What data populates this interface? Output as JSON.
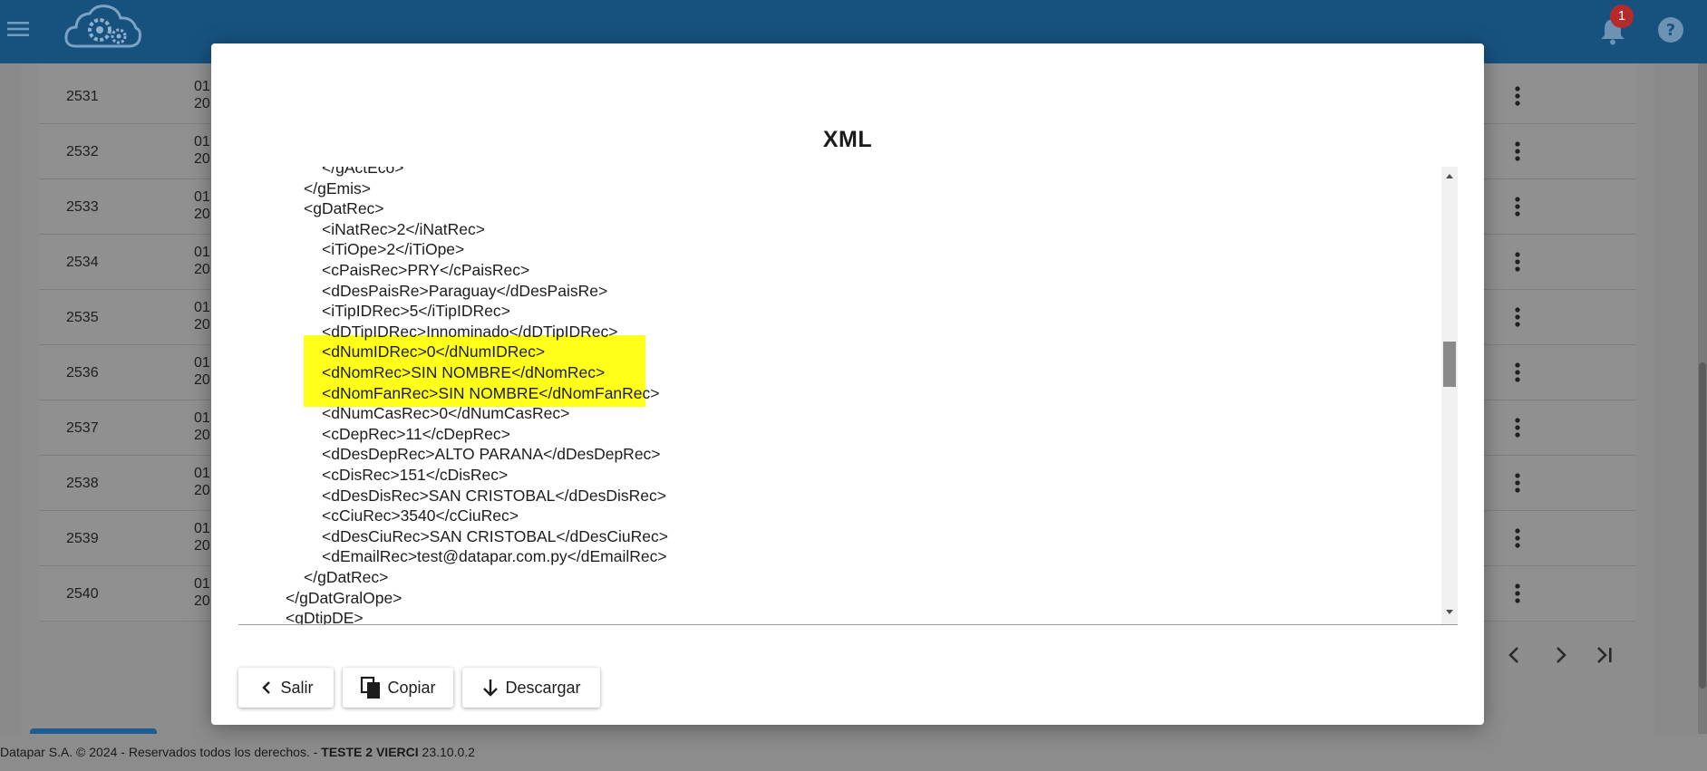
{
  "header": {
    "menu_icon": "menu-icon",
    "logo_icon": "cloud-gears-logo",
    "notifications_count": "1",
    "bell_icon": "bell-icon",
    "help_icon": "help-icon"
  },
  "table": {
    "rows": [
      {
        "id": "2531",
        "date_line1": "01",
        "date_line2": "20"
      },
      {
        "id": "2532",
        "date_line1": "01",
        "date_line2": "20"
      },
      {
        "id": "2533",
        "date_line1": "01",
        "date_line2": "20"
      },
      {
        "id": "2534",
        "date_line1": "01",
        "date_line2": "20"
      },
      {
        "id": "2535",
        "date_line1": "01",
        "date_line2": "20"
      },
      {
        "id": "2536",
        "date_line1": "01",
        "date_line2": "20"
      },
      {
        "id": "2537",
        "date_line1": "01",
        "date_line2": "20"
      },
      {
        "id": "2538",
        "date_line1": "01",
        "date_line2": "20"
      },
      {
        "id": "2539",
        "date_line1": "01",
        "date_line2": "20"
      },
      {
        "id": "2540",
        "date_line1": "01",
        "date_line2": "20"
      }
    ]
  },
  "footer": {
    "copyright": "Datapar S.A. © 2024 - Reservados todos los derechos. - ",
    "environment": "TESTE 2 VIERCI",
    "version": " 23.10.0.2"
  },
  "modal": {
    "title": "XML",
    "highlight_color": "#ffff1a",
    "xml_lines": [
      {
        "indent": 4,
        "text": "</gActEco>"
      },
      {
        "indent": 3,
        "text": "</gEmis>"
      },
      {
        "indent": 3,
        "text": "<gDatRec>"
      },
      {
        "indent": 4,
        "text": "<iNatRec>2</iNatRec>"
      },
      {
        "indent": 4,
        "text": "<iTiOpe>2</iTiOpe>"
      },
      {
        "indent": 4,
        "text": "<cPaisRec>PRY</cPaisRec>"
      },
      {
        "indent": 4,
        "text": "<dDesPaisRe>Paraguay</dDesPaisRe>"
      },
      {
        "indent": 4,
        "text": "<iTipIDRec>5</iTipIDRec>"
      },
      {
        "indent": 4,
        "text": "<dDTipIDRec>Innominado</dDTipIDRec>"
      },
      {
        "indent": 4,
        "text": "<dNumIDRec>0</dNumIDRec>"
      },
      {
        "indent": 4,
        "text": "<dNomRec>SIN NOMBRE</dNomRec>"
      },
      {
        "indent": 4,
        "text": "<dNomFanRec>SIN NOMBRE</dNomFanRec>"
      },
      {
        "indent": 4,
        "text": "<dNumCasRec>0</dNumCasRec>"
      },
      {
        "indent": 4,
        "text": "<cDepRec>11</cDepRec>"
      },
      {
        "indent": 4,
        "text": "<dDesDepRec>ALTO PARANA</dDesDepRec>"
      },
      {
        "indent": 4,
        "text": "<cDisRec>151</cDisRec>"
      },
      {
        "indent": 4,
        "text": "<dDesDisRec>SAN CRISTOBAL</dDesDisRec>"
      },
      {
        "indent": 4,
        "text": "<cCiuRec>3540</cCiuRec>"
      },
      {
        "indent": 4,
        "text": "<dDesCiuRec>SAN CRISTOBAL</dDesCiuRec>"
      },
      {
        "indent": 4,
        "text": "<dEmailRec>test@datapar.com.py</dEmailRec>"
      },
      {
        "indent": 3,
        "text": "</gDatRec>"
      },
      {
        "indent": 2,
        "text": "</gDatGralOpe>"
      },
      {
        "indent": 2,
        "text": "<gDtipDE>"
      }
    ],
    "buttons": {
      "exit_label": "Salir",
      "copy_label": "Copiar",
      "download_label": "Descargar"
    }
  }
}
